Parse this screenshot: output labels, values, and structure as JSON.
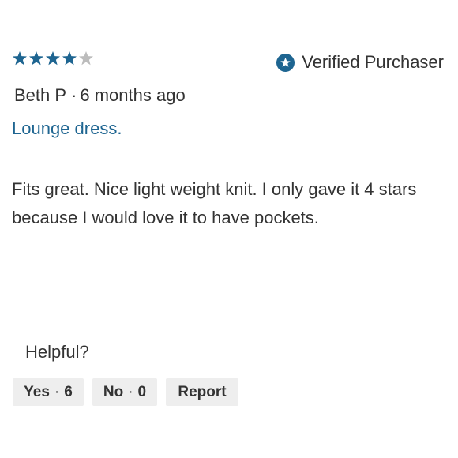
{
  "rating": {
    "value": 4,
    "max": 5,
    "filled_color": "#1e6591",
    "empty_color": "#bcbcbc"
  },
  "verified": {
    "label": "Verified Purchaser",
    "icon": "star-circle-icon",
    "icon_color": "#1e6591"
  },
  "reviewer": {
    "name": "Beth P",
    "separator": "·",
    "time_ago": "6 months ago"
  },
  "title": "Lounge dress.",
  "body": "Fits great. Nice light weight knit. I only gave it 4 stars because I would love it to have pockets.",
  "helpful": {
    "label": "Helpful?",
    "yes_label": "Yes",
    "yes_count": "6",
    "no_label": "No",
    "no_count": "0",
    "separator": "·",
    "report_label": "Report"
  }
}
